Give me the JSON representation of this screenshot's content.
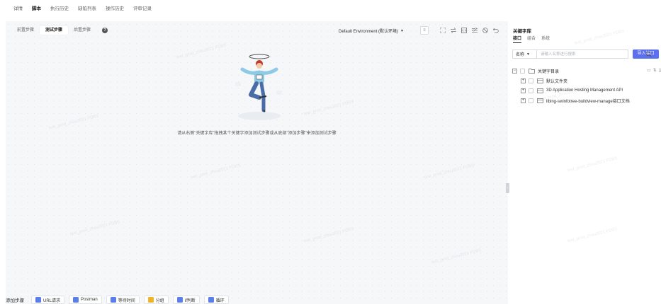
{
  "top_tabs": [
    "详情",
    "脚本",
    "执行历史",
    "缺陷列表",
    "操作历史",
    "评审记录"
  ],
  "top_tabs_active": 1,
  "editor": {
    "step_tabs": [
      "前置步骤",
      "测试步骤",
      "后置步骤"
    ],
    "step_tabs_active": 1,
    "environment": "Default Environment (默认环境)",
    "empty_hint": "请从右侧\"关键字库\"拖拽某个关键字添加测试步骤或从底部\"添加步骤\"来添加测试步骤",
    "watermark": "test_prod_zhou2021 FDBS"
  },
  "bottom_bar": {
    "label": "添加步骤",
    "buttons": [
      {
        "label": "URL请求",
        "icon": "url-request-icon"
      },
      {
        "label": "Postman",
        "icon": "postman-icon"
      },
      {
        "label": "等待时间",
        "icon": "wait-time-icon"
      },
      {
        "label": "分组",
        "icon": "group-icon"
      },
      {
        "label": "if判断",
        "icon": "if-condition-icon"
      },
      {
        "label": "循环",
        "icon": "loop-icon"
      }
    ]
  },
  "keyword_library": {
    "title": "关键字库",
    "tabs": [
      "接口",
      "组合",
      "系统"
    ],
    "tabs_active": 0,
    "search": {
      "field": "名称",
      "placeholder": "请输入名称进行搜索"
    },
    "import_button": "导入接口",
    "tree": {
      "root": "关键字目录",
      "children": [
        "默认文件夹",
        "3D Application Hosting Management API",
        "libing-swinfotree-buildview-manage接口文档"
      ]
    }
  },
  "colors": {
    "accent": "#5b6ff0",
    "icon_blue": "#5b7fe6",
    "icon_yellow": "#f0b429"
  }
}
